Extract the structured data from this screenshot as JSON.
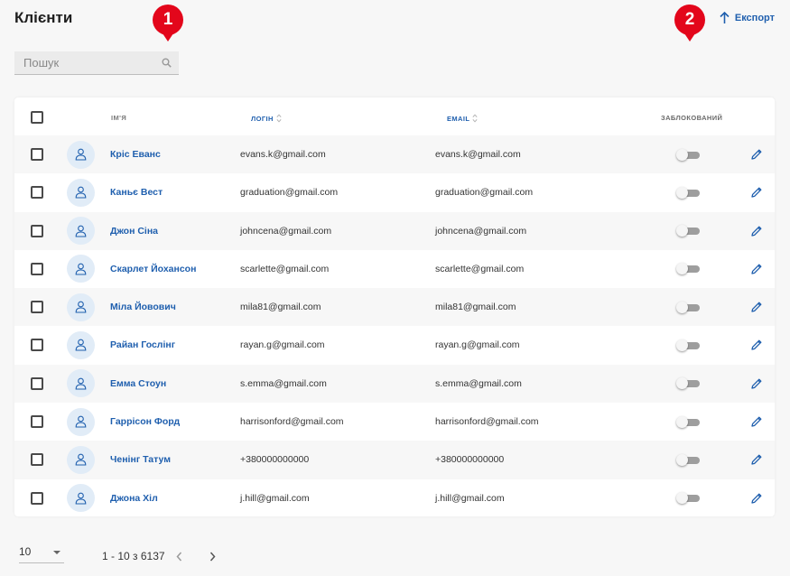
{
  "header": {
    "title": "Клієнти",
    "export_label": "Експорт"
  },
  "annotations": [
    "1",
    "2"
  ],
  "search": {
    "placeholder": "Пошук"
  },
  "table": {
    "columns": {
      "name": "ІМ'Я",
      "login": "ЛОГІН",
      "email": "EMAIL",
      "blocked": "ЗАБЛОКОВАНИЙ"
    },
    "rows": [
      {
        "name": "Кріс Еванс",
        "login": "evans.k@gmail.com",
        "email": "evans.k@gmail.com",
        "blocked": false
      },
      {
        "name": "Каньє Вест",
        "login": "graduation@gmail.com",
        "email": "graduation@gmail.com",
        "blocked": false
      },
      {
        "name": "Джон Сіна",
        "login": "johncena@gmail.com",
        "email": "johncena@gmail.com",
        "blocked": false
      },
      {
        "name": "Скарлет Йохансон",
        "login": "scarlette@gmail.com",
        "email": "scarlette@gmail.com",
        "blocked": false
      },
      {
        "name": "Міла Йовович",
        "login": "mila81@gmail.com",
        "email": "mila81@gmail.com",
        "blocked": false
      },
      {
        "name": "Райан Гослінг",
        "login": "rayan.g@gmail.com",
        "email": "rayan.g@gmail.com",
        "blocked": false
      },
      {
        "name": "Емма Стоун",
        "login": "s.emma@gmail.com",
        "email": "s.emma@gmail.com",
        "blocked": false
      },
      {
        "name": "Гаррісон Форд",
        "login": "harrisonford@gmail.com",
        "email": "harrisonford@gmail.com",
        "blocked": false
      },
      {
        "name": "Ченінг Татум",
        "login": "+380000000000",
        "email": "+380000000000",
        "blocked": false
      },
      {
        "name": "Джона Хіл",
        "login": "j.hill@gmail.com",
        "email": "j.hill@gmail.com",
        "blocked": false
      }
    ]
  },
  "pagination": {
    "page_size": "10",
    "range": "1 - 10 з 6137"
  },
  "colors": {
    "accent": "#1f5fae",
    "badge": "#e3061b",
    "avatar_bg": "#e1ecf7"
  },
  "icons": {
    "export": "arrow-up-icon",
    "search": "search-icon",
    "avatar": "user-icon",
    "edit": "pencil-icon",
    "sort": "sort-icon",
    "prev": "chevron-left-icon",
    "next": "chevron-right-icon"
  }
}
